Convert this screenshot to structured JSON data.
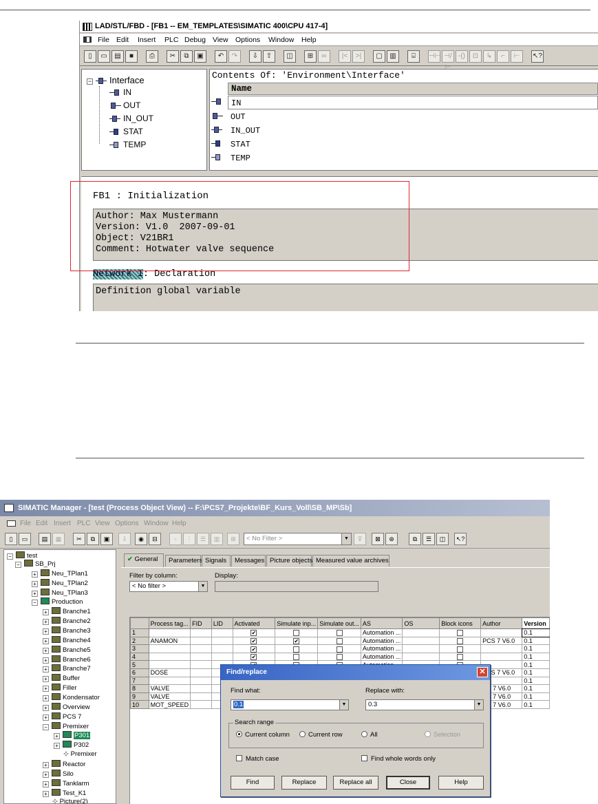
{
  "editor": {
    "title": "LAD/STL/FBD - [FB1 -- EM_TEMPLATES\\SIMATIC 400\\CPU 417-4]",
    "menu": [
      "File",
      "Edit",
      "Insert",
      "PLC",
      "Debug",
      "View",
      "Options",
      "Window",
      "Help"
    ],
    "interface_tree": {
      "root": "Interface",
      "items": [
        "IN",
        "OUT",
        "IN_OUT",
        "STAT",
        "TEMP"
      ]
    },
    "contents": {
      "header": "Contents Of: 'Environment\\Interface'",
      "column": "Name",
      "rows": [
        "IN",
        "OUT",
        "IN_OUT",
        "STAT",
        "TEMP"
      ]
    },
    "block_title": "FB1 : Initialization",
    "block_comment": [
      "Author: Max Mustermann",
      "Version: V1.0  2007-09-01",
      "Object: V21BR1",
      "Comment: Hotwater valve sequence"
    ],
    "network_label": "Network 1",
    "network_title": ": Declaration",
    "network_comment": "Definition global variable"
  },
  "manager": {
    "title": "SIMATIC Manager - [test (Process Object View) -- F:\\PCS7_Projekte\\BF_Kurs_Voll\\SB_MP\\Sb]",
    "menu": [
      "File",
      "Edit",
      "Insert",
      "PLC",
      "View",
      "Options",
      "Window",
      "Help"
    ],
    "filter_combo": "< No Filter >",
    "tree": {
      "root": "test",
      "project": "SB_Prj",
      "items": [
        "Neu_TPlan1",
        "Neu_TPlan2",
        "Neu_TPlan3",
        "Production",
        "Branche1",
        "Branche2",
        "Branche3",
        "Branche4",
        "Branche5",
        "Branche6",
        "Branche7",
        "Buffer",
        "Filler",
        "Kondensator",
        "Overview",
        "PCS 7",
        "Premixer",
        "P301",
        "P302",
        "Premixer",
        "Reactor",
        "Silo",
        "Tanklarm",
        "Test_K1",
        "Picture(2)"
      ]
    },
    "tabs": [
      "General",
      "Parameters",
      "Signals",
      "Messages",
      "Picture objects",
      "Measured value archives"
    ],
    "filter_by_column_label": "Filter by column:",
    "filter_value": "< No filter >",
    "display_label": "Display:",
    "columns": [
      "Process tag...",
      "FID",
      "LID",
      "Activated",
      "Simulate inp...",
      "Simulate out...",
      "AS",
      "OS",
      "Block icons",
      "Author",
      "Version"
    ],
    "rows": [
      {
        "n": "1",
        "tag": "",
        "as": "Automation ...",
        "author": "",
        "version": "0.1",
        "sim_in": false
      },
      {
        "n": "2",
        "tag": "ANAMON",
        "as": "Automation ...",
        "author": "PCS 7 V6.0",
        "version": "0.1",
        "sim_in": true
      },
      {
        "n": "3",
        "tag": "",
        "as": "Automation ...",
        "author": "",
        "version": "0.1",
        "sim_in": false
      },
      {
        "n": "4",
        "tag": "",
        "as": "Automation ...",
        "author": "",
        "version": "0.1",
        "sim_in": false
      },
      {
        "n": "5",
        "tag": "",
        "as": "Automation ...",
        "author": "",
        "version": "0.1",
        "sim_in": false
      },
      {
        "n": "6",
        "tag": "DOSE",
        "as": "Automation ...",
        "author": "PCS 7 V6.0",
        "version": "0.1",
        "sim_in": true
      },
      {
        "n": "7",
        "tag": "",
        "as": "",
        "author": "",
        "version": "0.1",
        "sim_in": false
      },
      {
        "n": "8",
        "tag": "VALVE",
        "as": "",
        "author": "CS 7 V6.0",
        "version": "0.1",
        "sim_in": false
      },
      {
        "n": "9",
        "tag": "VALVE",
        "as": "",
        "author": "CS 7 V6.0",
        "version": "0.1",
        "sim_in": false
      },
      {
        "n": "10",
        "tag": "MOT_SPEED",
        "as": "",
        "author": "CS 7 V6.0",
        "version": "0.1",
        "sim_in": false
      }
    ]
  },
  "find_replace": {
    "title": "Find/replace",
    "find_label": "Find what:",
    "find_value": "0.1",
    "replace_label": "Replace with:",
    "replace_value": "0.3",
    "search_range_label": "Search range",
    "options": [
      "Current column",
      "Current row",
      "All",
      "Selection"
    ],
    "match_case": "Match case",
    "whole_words": "Find whole words only",
    "buttons": [
      "Find",
      "Replace",
      "Replace all",
      "Close",
      "Help"
    ]
  }
}
